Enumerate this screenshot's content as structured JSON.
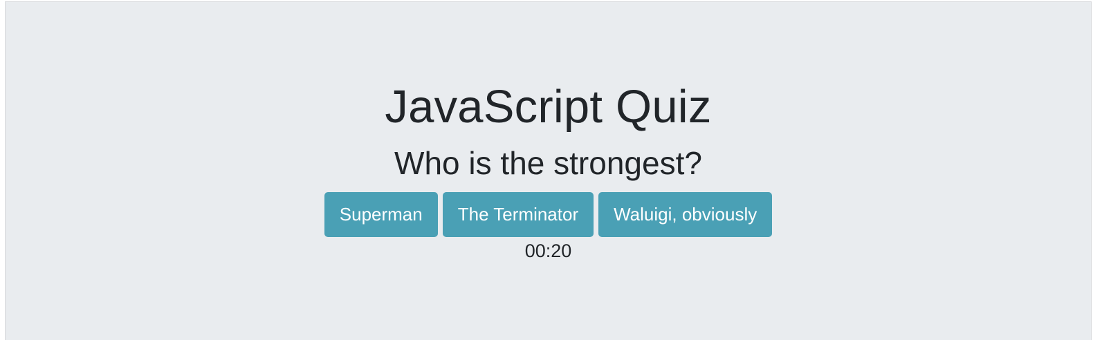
{
  "quiz": {
    "title": "JavaScript Quiz",
    "question": "Who is the strongest?",
    "answers": [
      {
        "label": "Superman"
      },
      {
        "label": "The Terminator"
      },
      {
        "label": "Waluigi, obviously"
      }
    ],
    "timer": "00:20"
  },
  "colors": {
    "background": "#e9ecef",
    "button": "#4aa0b5",
    "button_text": "#ffffff",
    "text": "#212529"
  }
}
